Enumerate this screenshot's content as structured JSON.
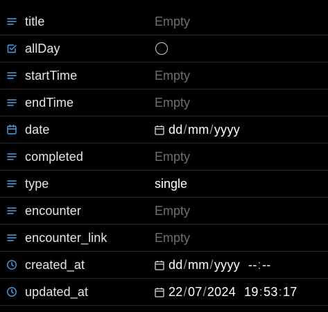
{
  "properties": [
    {
      "icon": "text-lines-icon",
      "name": "title",
      "value": "Empty",
      "kind": "empty"
    },
    {
      "icon": "checkbox-icon",
      "name": "allDay",
      "kind": "checkbox",
      "checked": false
    },
    {
      "icon": "text-lines-icon",
      "name": "startTime",
      "value": "Empty",
      "kind": "empty"
    },
    {
      "icon": "text-lines-icon",
      "name": "endTime",
      "value": "Empty",
      "kind": "empty"
    },
    {
      "icon": "calendar-icon",
      "name": "date",
      "kind": "date",
      "day": "dd",
      "month": "mm",
      "year": "yyyy"
    },
    {
      "icon": "text-lines-icon",
      "name": "completed",
      "value": "Empty",
      "kind": "empty"
    },
    {
      "icon": "text-lines-icon",
      "name": "type",
      "value": "single",
      "kind": "text"
    },
    {
      "icon": "text-lines-icon",
      "name": "encounter",
      "value": "Empty",
      "kind": "empty"
    },
    {
      "icon": "text-lines-icon",
      "name": "encounter_link",
      "value": "Empty",
      "kind": "empty"
    },
    {
      "icon": "clock-icon",
      "name": "created_at",
      "kind": "datetime",
      "day": "dd",
      "month": "mm",
      "year": "yyyy",
      "hour": "--",
      "minute": "--",
      "second": ""
    },
    {
      "icon": "clock-icon",
      "name": "updated_at",
      "kind": "datetime",
      "day": "22",
      "month": "07",
      "year": "2024",
      "hour": "19",
      "minute": "53",
      "second": "17"
    }
  ],
  "colors": {
    "accent": "#4aa3e8",
    "empty_text": "#6f6f6f",
    "background": "#000000",
    "divider": "#2c2c2c"
  }
}
